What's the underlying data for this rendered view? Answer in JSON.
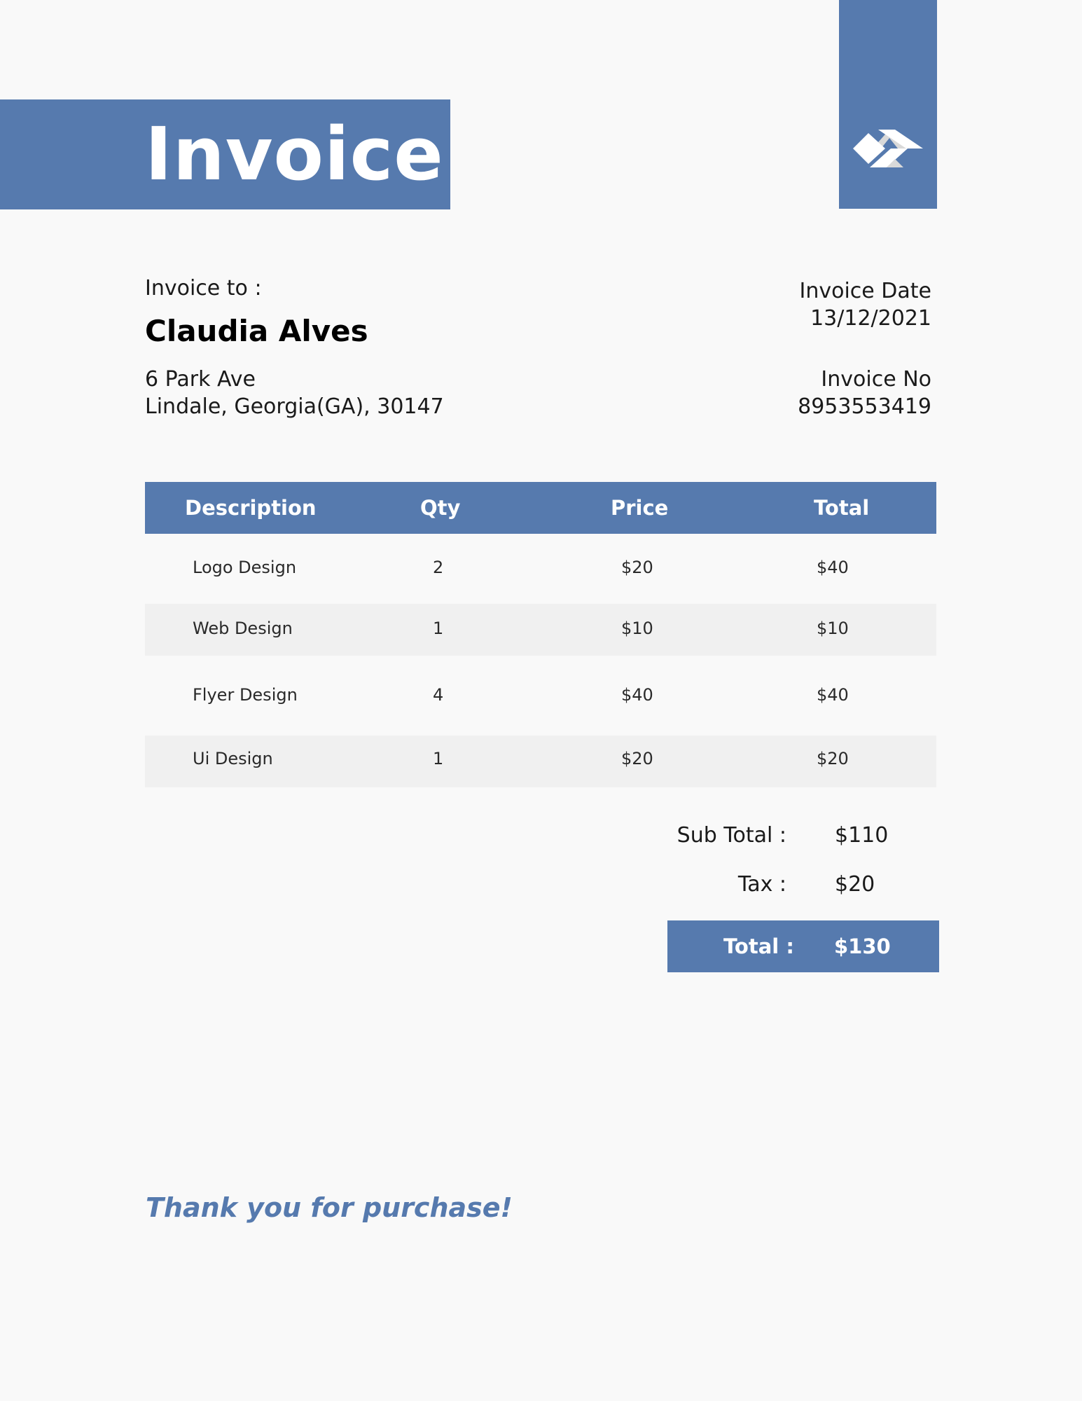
{
  "header": {
    "title": "Invoice"
  },
  "bill_to": {
    "label": "Invoice to :",
    "name": "Claudia Alves",
    "address_line1": "6 Park Ave",
    "address_line2": "Lindale, Georgia(GA), 30147"
  },
  "meta": {
    "date_label": "Invoice Date",
    "date_value": "13/12/2021",
    "number_label": "Invoice No",
    "number_value": "8953553419"
  },
  "table": {
    "headers": [
      "Description",
      "Qty",
      "Price",
      "Total"
    ],
    "rows": [
      [
        "Logo Design",
        "2",
        "$20",
        "$40"
      ],
      [
        "Web Design",
        "1",
        "$10",
        "$10"
      ],
      [
        "Flyer Design",
        "4",
        "$40",
        "$40"
      ],
      [
        "Ui Design",
        "1",
        "$20",
        "$20"
      ]
    ]
  },
  "totals": {
    "subtotal_label": "Sub Total :",
    "subtotal_value": "$110",
    "tax_label": "Tax :",
    "tax_value": "$20",
    "total_label": "Total :",
    "total_value": "$130"
  },
  "footer": {
    "thanks": "Thank you for purchase!"
  },
  "colors": {
    "accent": "#567aae",
    "row_shade": "#f0f0f0",
    "background": "#f9f9f9"
  },
  "icons": {
    "logo": "diamond-chevron-logo-icon"
  }
}
